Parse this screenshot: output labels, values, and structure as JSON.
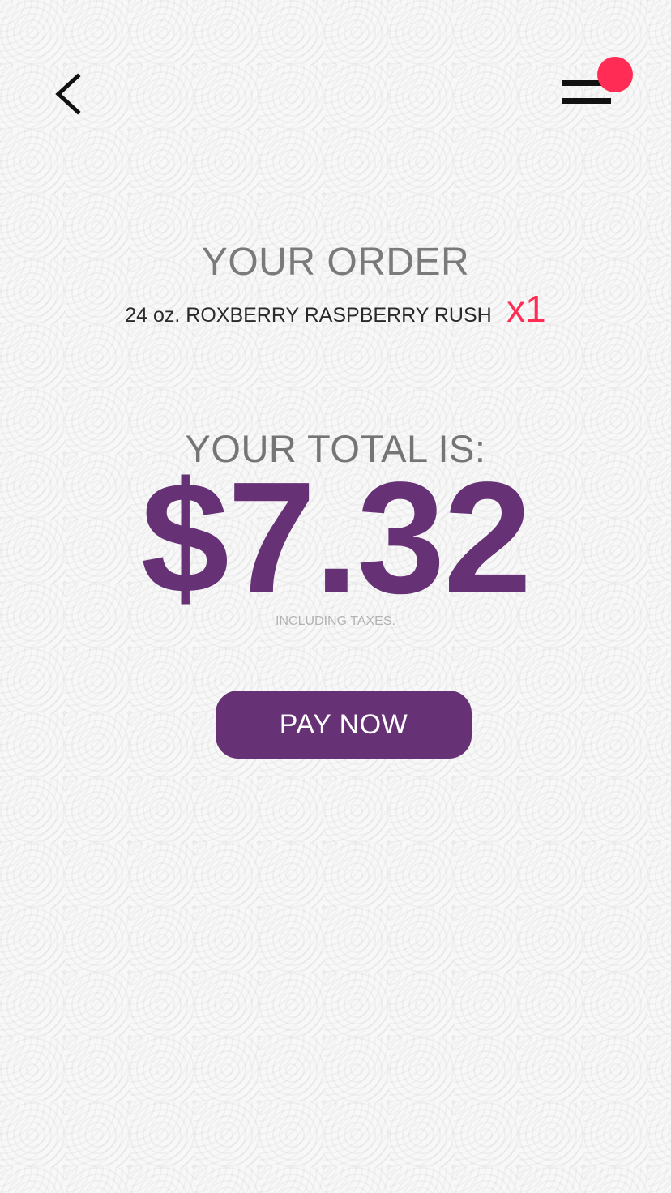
{
  "header": {
    "back_icon": "chevron-left-icon",
    "menu_icon": "hamburger-menu-icon",
    "notification_color": "#ff2d55"
  },
  "order": {
    "title": "YOUR ORDER",
    "item": "24 oz. ROXBERRY RASPBERRY RUSH",
    "quantity": "x1"
  },
  "total": {
    "label": "YOUR TOTAL IS:",
    "amount": "$7.32",
    "note": "INCLUDING TAXES."
  },
  "actions": {
    "pay_label": "PAY NOW"
  },
  "colors": {
    "brand": "#663275",
    "accent": "#ff2d55"
  }
}
